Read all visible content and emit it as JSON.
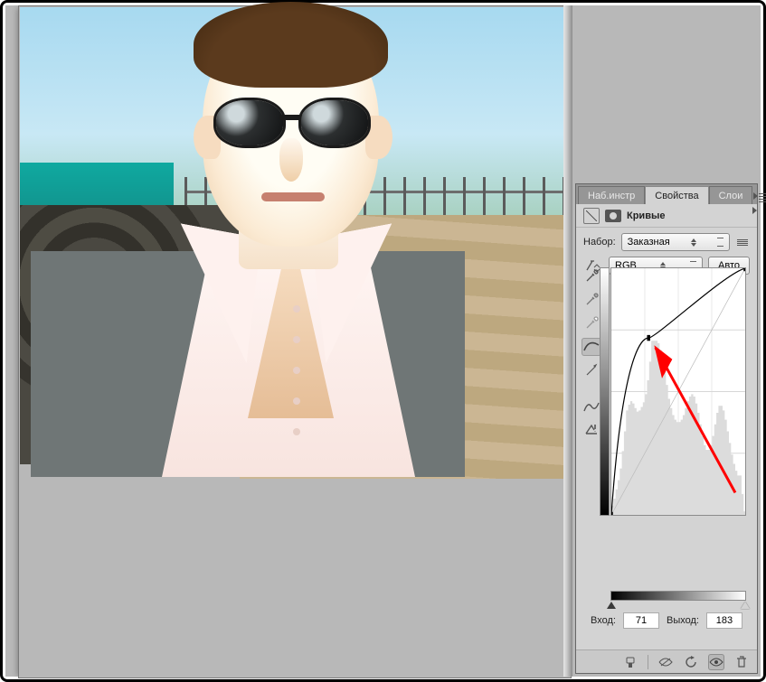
{
  "tabs": {
    "tools_preset": "Наб.инстр",
    "properties": "Свойства",
    "layers": "Слои"
  },
  "header": {
    "title": "Кривые"
  },
  "preset": {
    "label": "Набор:",
    "value": "Заказная"
  },
  "channel": {
    "value": "RGB",
    "auto_label": "Авто"
  },
  "io": {
    "input_label": "Вход:",
    "input_value": "71",
    "output_label": "Выход:",
    "output_value": "183"
  },
  "chart_data": {
    "type": "line",
    "title": "Кривые",
    "xlabel": "Вход",
    "ylabel": "Выход",
    "xlim": [
      0,
      255
    ],
    "ylim": [
      0,
      255
    ],
    "grid": true,
    "series": [
      {
        "name": "curve",
        "x": [
          0,
          71,
          255
        ],
        "y": [
          0,
          183,
          255
        ]
      },
      {
        "name": "identity",
        "x": [
          0,
          255
        ],
        "y": [
          0,
          255
        ]
      }
    ],
    "control_point": {
      "x": 71,
      "y": 183
    },
    "histogram": {
      "x_step": 4,
      "values": [
        8,
        14,
        22,
        30,
        40,
        55,
        72,
        90,
        95,
        98,
        96,
        92,
        89,
        90,
        93,
        97,
        104,
        116,
        132,
        150,
        150,
        150,
        148,
        142,
        134,
        124,
        112,
        100,
        92,
        86,
        82,
        80,
        80,
        82,
        86,
        92,
        98,
        102,
        104,
        102,
        96,
        88,
        78,
        68,
        60,
        56,
        56,
        60,
        68,
        78,
        88,
        94,
        94,
        90,
        82,
        72,
        62,
        52,
        44,
        38,
        34,
        34,
        18,
        3
      ]
    },
    "annotation_arrow": {
      "from": [
        236,
        232
      ],
      "to": [
        84,
        82
      ],
      "color": "#ff0000"
    }
  }
}
